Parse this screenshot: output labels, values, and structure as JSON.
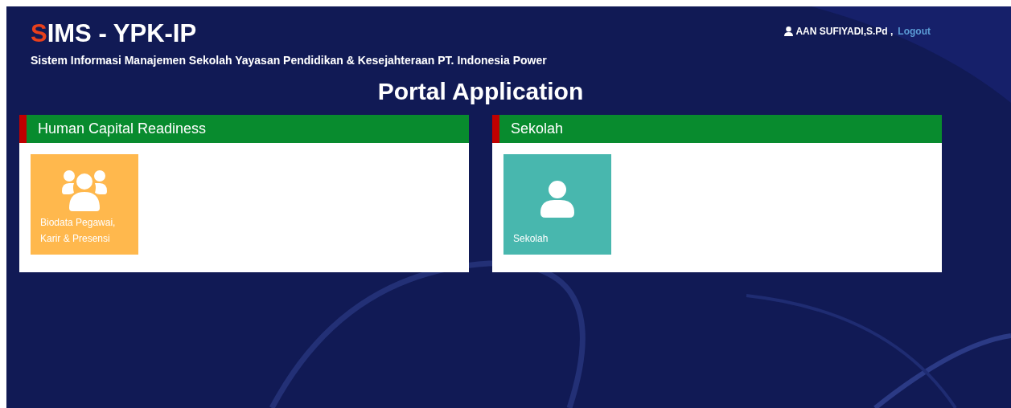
{
  "header": {
    "title_accent": "S",
    "title_rest": "IMS - YPK-IP",
    "subtitle": "Sistem Informasi Manajemen Sekolah Yayasan Pendidikan & Kesejahteraan PT. Indonesia Power",
    "user": "AAN SUFIYADI,S.Pd ,",
    "logout": "Logout"
  },
  "page_title": "Portal Application",
  "panels": [
    {
      "title": "Human Capital Readiness",
      "tiles": [
        {
          "kind": "group",
          "label": "Biodata Pegawai, Karir & Presensi",
          "color": "#ffb84d"
        }
      ]
    },
    {
      "title": "Sekolah",
      "tiles": [
        {
          "kind": "person",
          "label": "Sekolah",
          "color": "#48b7ae"
        }
      ]
    }
  ]
}
